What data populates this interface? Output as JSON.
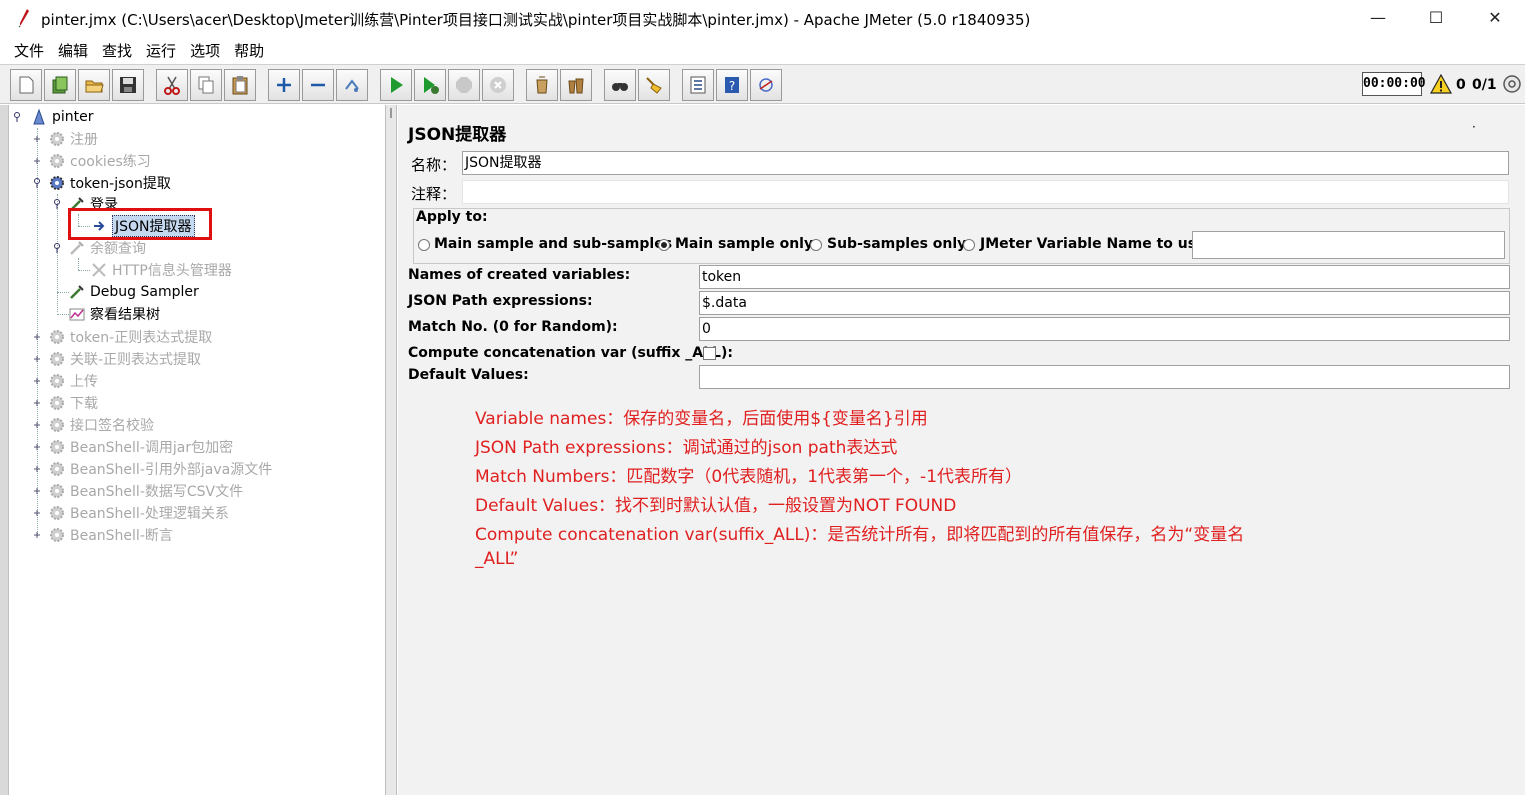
{
  "window": {
    "title": "pinter.jmx (C:\\Users\\acer\\Desktop\\Jmeter训练营\\Pinter项目接口测试实战\\pinter项目实战脚本\\pinter.jmx) - Apache JMeter (5.0 r1840935)",
    "minimize": "—",
    "maximize": "☐",
    "close": "✕"
  },
  "menu": [
    "文件",
    "编辑",
    "查找",
    "运行",
    "选项",
    "帮助"
  ],
  "toolbar": {
    "buttons": [
      "new-icon",
      "templates-icon",
      "open-icon",
      "save-icon",
      "cut-icon",
      "copy-icon",
      "paste-icon",
      "expand-icon",
      "collapse-icon",
      "toggle-icon",
      "start-icon",
      "start-no-pause-icon",
      "stop-icon",
      "shutdown-icon",
      "clear-icon",
      "clear-all-icon",
      "search-icon",
      "reset-search-icon",
      "function-helper-icon",
      "help-icon",
      "remote-icon"
    ],
    "timer": "00:00:00",
    "warnings": "0",
    "threads": "0/1"
  },
  "tree": {
    "root": "pinter",
    "items": [
      {
        "label": "注册",
        "disabled": true
      },
      {
        "label": "cookies练习",
        "disabled": true
      },
      {
        "label": "token-json提取",
        "disabled": false
      },
      {
        "label": "登录",
        "disabled": false
      },
      {
        "label": "JSON提取器",
        "disabled": false,
        "selected": true
      },
      {
        "label": "余额查询",
        "disabled": true
      },
      {
        "label": "HTTP信息头管理器",
        "disabled": true
      },
      {
        "label": "Debug Sampler",
        "disabled": false
      },
      {
        "label": "察看结果树",
        "disabled": false
      },
      {
        "label": "token-正则表达式提取",
        "disabled": true
      },
      {
        "label": "关联-正则表达式提取",
        "disabled": true
      },
      {
        "label": "上传",
        "disabled": true
      },
      {
        "label": "下载",
        "disabled": true
      },
      {
        "label": "接口签名校验",
        "disabled": true
      },
      {
        "label": "BeanShell-调用jar包加密",
        "disabled": true
      },
      {
        "label": "BeanShell-引用外部java源文件",
        "disabled": true
      },
      {
        "label": "BeanShell-数据写CSV文件",
        "disabled": true
      },
      {
        "label": "BeanShell-处理逻辑关系",
        "disabled": true
      },
      {
        "label": "BeanShell-断言",
        "disabled": true
      }
    ]
  },
  "panel": {
    "title": "JSON提取器",
    "dot": "·",
    "name_label": "名称：",
    "name_value": "JSON提取器",
    "comment_label": "注释：",
    "comment_value": "",
    "apply_to_label": "Apply to:",
    "apply_options": [
      "Main sample and sub-samples",
      "Main sample only",
      "Sub-samples only",
      "JMeter Variable Name to use"
    ],
    "apply_selected": 1,
    "jmeter_var_value": "",
    "var_names_label": "Names of created variables:",
    "var_names_value": "token",
    "json_path_label": "JSON Path expressions:",
    "json_path_value": "$.data",
    "match_no_label": "Match No. (0 for Random):",
    "match_no_value": "0",
    "concat_label": "Compute concatenation var (suffix _ALL):",
    "concat_checked": false,
    "default_label": "Default Values:",
    "default_value": ""
  },
  "notes": [
    "Variable names：保存的变量名，后面使用${变量名}引用",
    "JSON Path  expressions：调试通过的json path表达式",
    "Match Numbers：匹配数字（0代表随机，1代表第一个，-1代表所有）",
    "Default Values：找不到时默认认值，一般设置为NOT FOUND",
    "Compute concatenation var(suffix_ALL)：是否统计所有，即将匹配到的所有值保存，名为“变量名",
    "_ALL”"
  ]
}
